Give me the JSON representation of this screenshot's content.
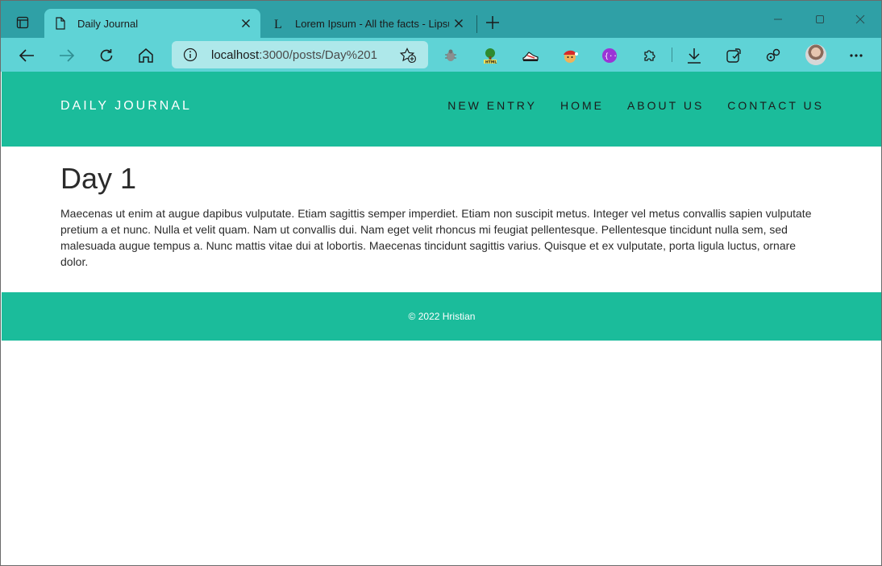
{
  "browser": {
    "tabs": [
      {
        "title": "Daily Journal",
        "active": true,
        "favicon": "page-icon"
      },
      {
        "title": "Lorem Ipsum - All the facts - Lipsum",
        "active": false,
        "favicon": "lipsum-l-icon"
      }
    ],
    "url_host": "localhost",
    "url_path": ":3000/posts/Day%201",
    "extensions": [
      "bug-extension-icon",
      "html-tree-extension-icon",
      "sneaker-extension-icon",
      "santa-extension-icon",
      "code-brackets-extension-icon",
      "puzzle-extensions-icon"
    ],
    "accent_color": "#5fd3d6",
    "tabstrip_color": "#2fa0a6"
  },
  "site": {
    "brand": "DAILY JOURNAL",
    "nav": [
      "NEW ENTRY",
      "HOME",
      "ABOUT US",
      "CONTACT US"
    ],
    "header_color": "#1bbc9b"
  },
  "post": {
    "title": "Day 1",
    "body": "Maecenas ut enim at augue dapibus vulputate. Etiam sagittis semper imperdiet. Etiam non suscipit metus. Integer vel metus convallis sapien vulputate pretium a et nunc. Nulla et velit quam. Nam ut convallis dui. Nam eget velit rhoncus mi feugiat pellentesque. Pellentesque tincidunt nulla sem, sed malesuada augue tempus a. Nunc mattis vitae dui at lobortis. Maecenas tincidunt sagittis varius. Quisque et ex vulputate, porta ligula luctus, ornare dolor."
  },
  "footer": {
    "text": "© 2022 Hristian"
  }
}
